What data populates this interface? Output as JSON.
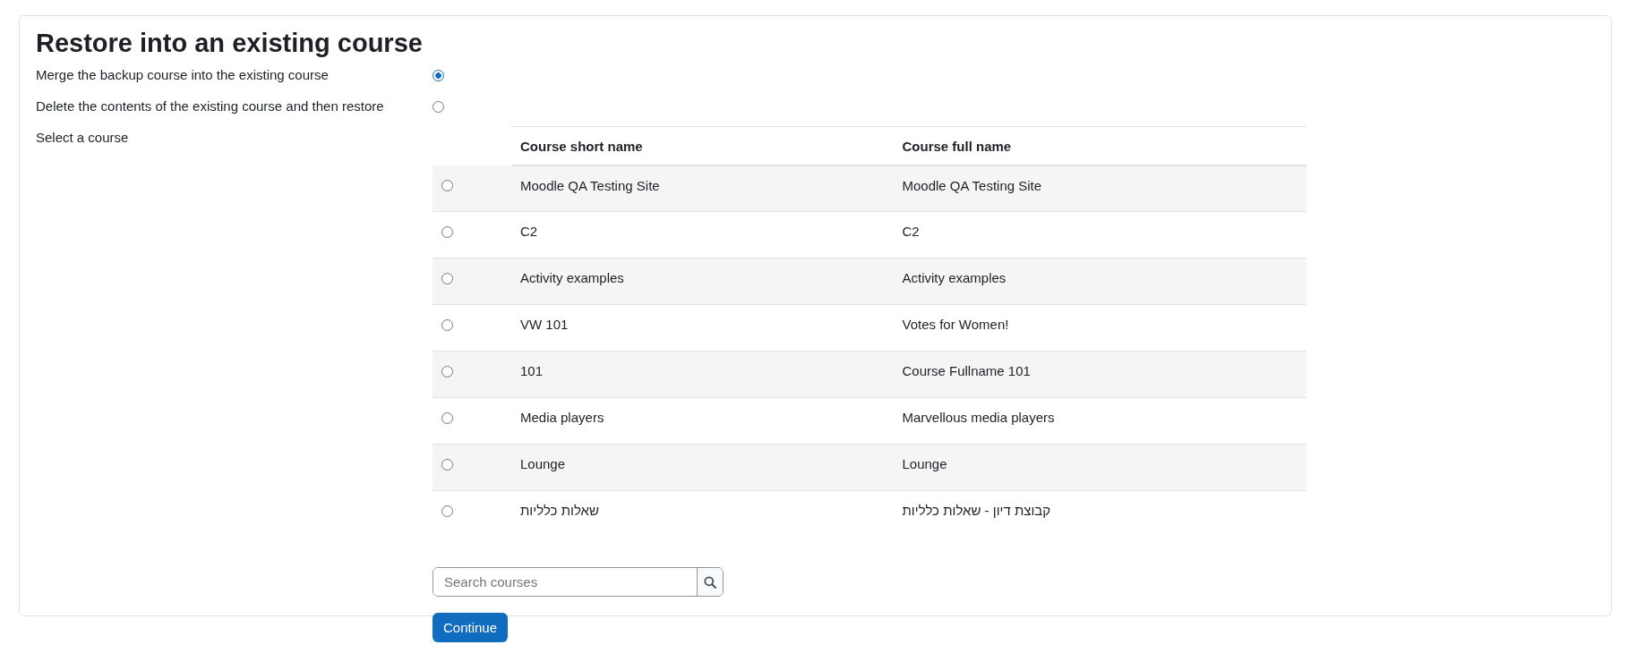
{
  "title": "Restore into an existing course",
  "options": [
    {
      "label": "Merge the backup course into the existing course",
      "selected": true
    },
    {
      "label": "Delete the contents of the existing course and then restore",
      "selected": false
    }
  ],
  "select_label": "Select a course",
  "table": {
    "columns": [
      "Course short name",
      "Course full name"
    ],
    "rows": [
      {
        "short_name": "Moodle QA Testing Site",
        "full_name": "Moodle QA Testing Site",
        "selected": false
      },
      {
        "short_name": "C2",
        "full_name": "C2",
        "selected": false
      },
      {
        "short_name": "Activity examples",
        "full_name": "Activity examples",
        "selected": false
      },
      {
        "short_name": "VW 101",
        "full_name": "Votes for Women!",
        "selected": false
      },
      {
        "short_name": "101",
        "full_name": "Course Fullname 101",
        "selected": false
      },
      {
        "short_name": "Media players",
        "full_name": "Marvellous media players",
        "selected": false
      },
      {
        "short_name": "Lounge",
        "full_name": "Lounge",
        "selected": false
      },
      {
        "short_name": "שאלות כלליות",
        "full_name": "קבוצת דיון - שאלות כלליות",
        "selected": false
      }
    ]
  },
  "search": {
    "placeholder": "Search courses"
  },
  "button": "Continue"
}
